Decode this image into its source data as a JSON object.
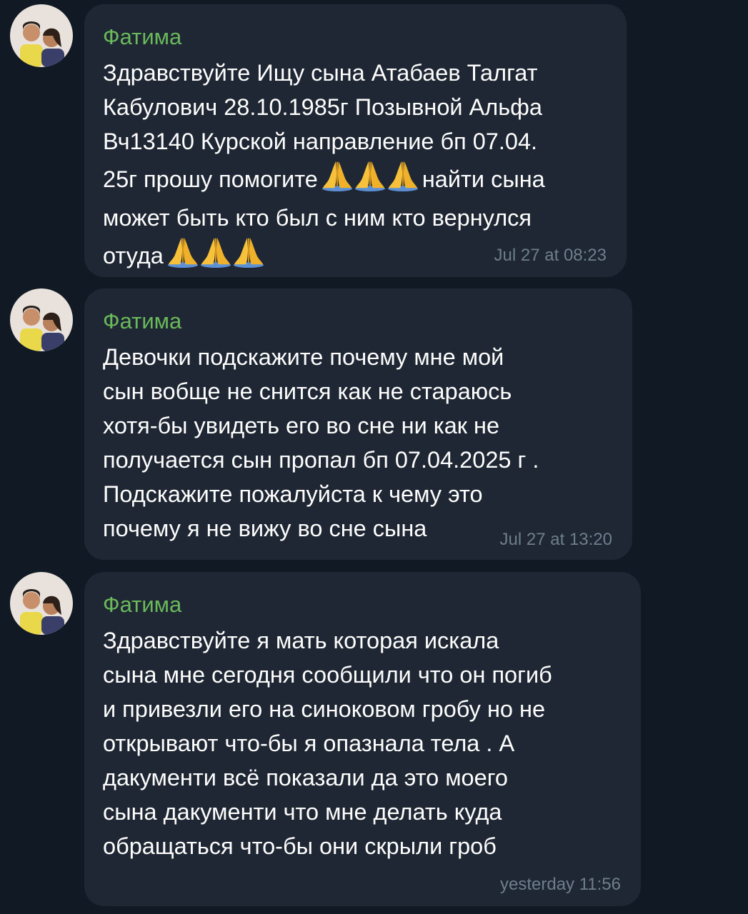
{
  "messages": [
    {
      "sender": "Фатима",
      "text_a": "Здравствуйте Ищу сына Атабаев Талгат\nКабулович 28.10.1985г Позывной Альфа\nВч13140 Курской направление бп 07.04.\n25г прошу помогите",
      "text_b": "найти сына\nможет быть кто был с ним кто вернулся\nотуда",
      "emoji": "folded-hands",
      "time": "Jul 27 at 08:23"
    },
    {
      "sender": "Фатима",
      "text": "Девочки подскажите почему мне мой\nсын вобще не снится как не стараюсь\nхотя-бы увидеть его во сне ни как не\nполучается сын пропал бп 07.04.2025 г .\nПодскажите пожалуйста к чему это\nпочему я не вижу во сне сына",
      "time": "Jul 27 at 13:20"
    },
    {
      "sender": "Фатима",
      "text": "Здравствуйте я мать которая искала\nсына мне сегодня сообщили что он погиб\nи привезли его на синоковом гробу но не\nоткрывают что-бы я опазнала тела . А\nдакументи всё показали да это моего\nсына дакументи что мне делать куда\nобращаться что-бы они скрыли гроб",
      "time": "yesterday 11:56"
    }
  ],
  "colors": {
    "background": "#111a24",
    "bubble": "#1e2733",
    "sender_name": "#6ab95a",
    "text": "#ffffff",
    "timestamp": "#6f7e8c"
  }
}
